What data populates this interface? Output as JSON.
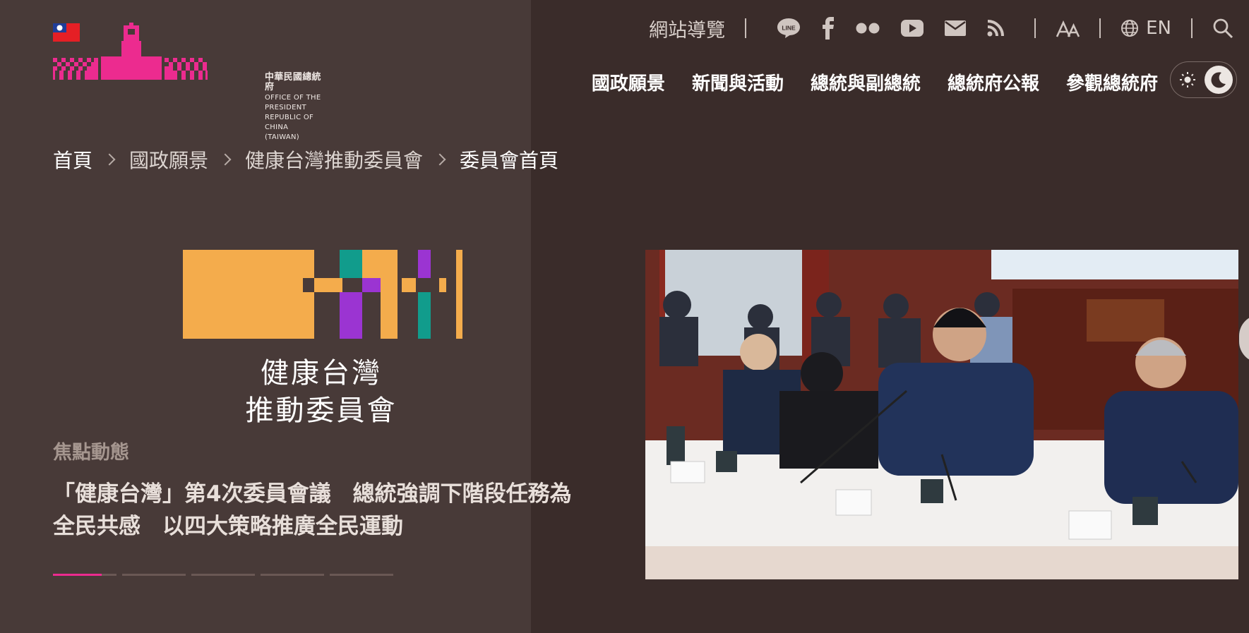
{
  "site": {
    "logo": {
      "name_zh": "中華民國總統府",
      "name_en_line1": "OFFICE OF THE PRESIDENT",
      "name_en_line2": "REPUBLIC OF CHINA (TAIWAN)",
      "brand_color": "#ec2b8f"
    }
  },
  "utility_bar": {
    "sitemap_label": "網站導覽",
    "social_icons": [
      "line-icon",
      "facebook-icon",
      "flickr-icon",
      "youtube-icon",
      "email-icon",
      "rss-icon"
    ],
    "line_text": "LINE",
    "lang_label": "EN"
  },
  "main_nav": {
    "items": [
      {
        "label": "國政願景"
      },
      {
        "label": "新聞與活動"
      },
      {
        "label": "總統與副總統"
      },
      {
        "label": "總統府公報"
      },
      {
        "label": "參觀總統府"
      }
    ]
  },
  "breadcrumb": {
    "items": [
      "首頁",
      "國政願景",
      "健康台灣推動委員會",
      "委員會首頁"
    ]
  },
  "hero": {
    "committee_name_line1": "健康台灣",
    "committee_name_line2": "推動委員會",
    "focus_label": "焦點動態",
    "headline": "「健康台灣」第4次委員會議　總統強調下階段任務為全民共感　以四大策略推廣全民運動",
    "slides_total": 5,
    "slide_active": 1
  },
  "colors": {
    "background": "#3a2c2a",
    "left_panel": "#483a38",
    "accent_pink": "#ec2b8f",
    "logo_orange": "#f4ac4c",
    "logo_teal": "#119c8c",
    "logo_purple": "#9b34d2"
  }
}
